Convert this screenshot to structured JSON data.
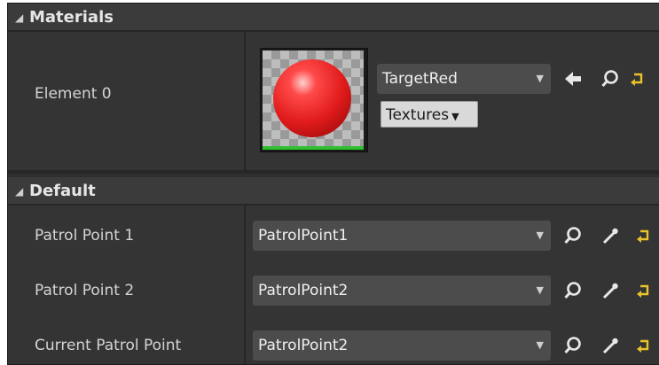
{
  "materials": {
    "header": "Materials",
    "element_label": "Element 0",
    "material_name": "TargetRed",
    "textures_button": "Textures"
  },
  "default": {
    "header": "Default",
    "rows": [
      {
        "label": "Patrol Point 1",
        "value": "PatrolPoint1"
      },
      {
        "label": "Patrol Point 2",
        "value": "PatrolPoint2"
      },
      {
        "label": "Current Patrol Point",
        "value": "PatrolPoint2"
      }
    ]
  },
  "icons": {
    "collapse": "triangle-down-icon",
    "use_selected": "arrow-left-icon",
    "browse": "search-icon",
    "pick_actor": "eyedropper-icon",
    "reset": "reset-to-default-icon"
  },
  "colors": {
    "panel_bg": "#2f2f2f",
    "header_bg": "#3b3b3b",
    "combo_bg": "#4c4c4c",
    "reset_yellow": "#e8c32a",
    "material_red": "#e01b1b"
  }
}
